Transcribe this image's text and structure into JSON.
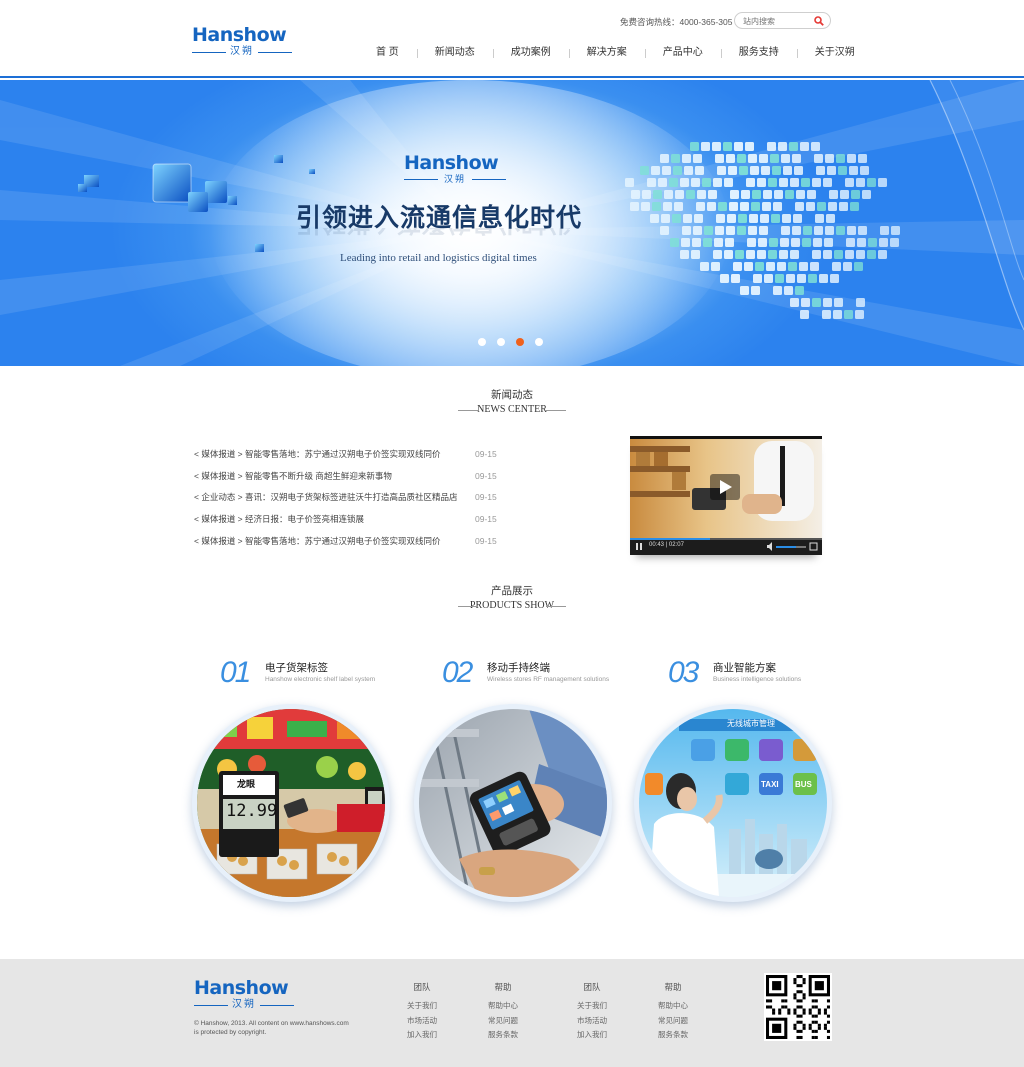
{
  "header": {
    "logo_text": "Hanshow",
    "logo_sub": "汉朔",
    "hotline": "免费咨询热线：4000-365-305",
    "search_placeholder": "站内搜索",
    "nav": [
      "首 页",
      "新闻动态",
      "成功案例",
      "解决方案",
      "产品中心",
      "服务支持",
      "关于汉朔"
    ]
  },
  "banner": {
    "logo_text": "Hanshow",
    "logo_sub": "汉朔",
    "title": "引领进入流通信息化时代",
    "subtitle": "Leading into retail and logistics digital times",
    "slides": 4,
    "active_slide": 3
  },
  "news": {
    "title_cn": "新闻动态",
    "title_en": "NEWS CENTER",
    "items": [
      {
        "text": "< 媒体报道 > 智能零售落地：苏宁通过汉朔电子价签实现双线同价",
        "date": "09-15"
      },
      {
        "text": "< 媒体报道 > 智能零售不断升级 商超生鲜迎来新事物",
        "date": "09-15"
      },
      {
        "text": "< 企业动态 > 喜讯：汉朔电子货架标签进驻沃牛打造高品质社区精品店",
        "date": "09-15"
      },
      {
        "text": "< 媒体报道 >  经济日报：电子价签亮相连锁展",
        "date": "09-15"
      },
      {
        "text": "< 媒体报道 > 智能零售落地：苏宁通过汉朔电子价签实现双线同价",
        "date": "09-15"
      }
    ],
    "video_time": "00:43 | 02:07"
  },
  "products": {
    "title_cn": "产品展示",
    "title_en": "PRODUCTS SHOW",
    "items": [
      {
        "num": "01",
        "title": "电子货架标签",
        "subtitle": "Hanshow electronic shelf label system",
        "price_label": "12.99",
        "tag_text": "龙眼"
      },
      {
        "num": "02",
        "title": "移动手持终端",
        "subtitle": "Wireless stores RF management solutions"
      },
      {
        "num": "03",
        "title": "商业智能方案",
        "subtitle": "Business intelligence solutions",
        "screen_title": "无线城市管理",
        "tiles": [
          "TAXI",
          "BUS"
        ]
      }
    ]
  },
  "footer": {
    "logo_text": "Hanshow",
    "logo_sub": "汉朔",
    "copyright": "© Hanshow, 2013. All content on www.hanshows.com is protected by copyright.",
    "columns": [
      {
        "head": "团队",
        "links": [
          "关于我们",
          "市场活动",
          "加入我们"
        ]
      },
      {
        "head": "帮助",
        "links": [
          "帮助中心",
          "常见问题",
          "服务条款"
        ]
      },
      {
        "head": "团队",
        "links": [
          "关于我们",
          "市场活动",
          "加入我们"
        ]
      },
      {
        "head": "帮助",
        "links": [
          "帮助中心",
          "常见问题",
          "服务条款"
        ]
      }
    ]
  },
  "colors": {
    "brand_blue": "#1565c0",
    "accent_orange": "#f0611c",
    "number_blue": "#3a8fe0"
  }
}
